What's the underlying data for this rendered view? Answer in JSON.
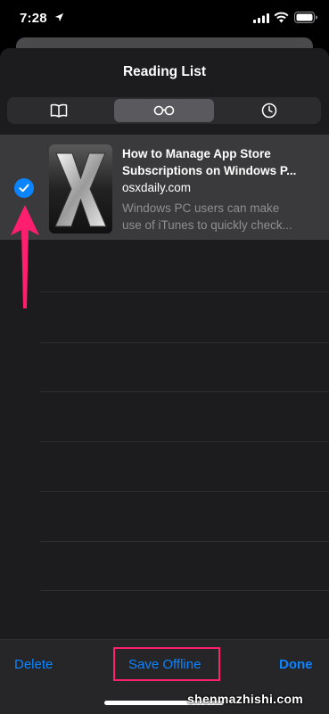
{
  "status_bar": {
    "time": "7:28",
    "icons": [
      "location-arrow-icon",
      "cellular-signal-icon",
      "wifi-icon",
      "battery-icon"
    ]
  },
  "sheet": {
    "title": "Reading List",
    "tabs": [
      {
        "icon": "book-icon",
        "selected": false
      },
      {
        "icon": "glasses-icon",
        "selected": true
      },
      {
        "icon": "clock-icon",
        "selected": false
      }
    ]
  },
  "item": {
    "title_line1": "How to Manage App Store",
    "title_line2": "Subscriptions on Windows P...",
    "source": "osxdaily.com",
    "snippet_line1": "Windows PC users can make",
    "snippet_line2": "use of iTunes to quickly check...",
    "selected": true,
    "thumbnail_icon": "macos-x-logo-icon"
  },
  "toolbar": {
    "delete_label": "Delete",
    "save_offline_label": "Save Offline",
    "done_label": "Done"
  },
  "annotation": {
    "color": "#ff1f6e"
  },
  "watermark": "shenmazhishi.com",
  "colors": {
    "accent": "#0a84ff",
    "background": "#1c1c1e",
    "selected_row": "#3a3a3c"
  }
}
